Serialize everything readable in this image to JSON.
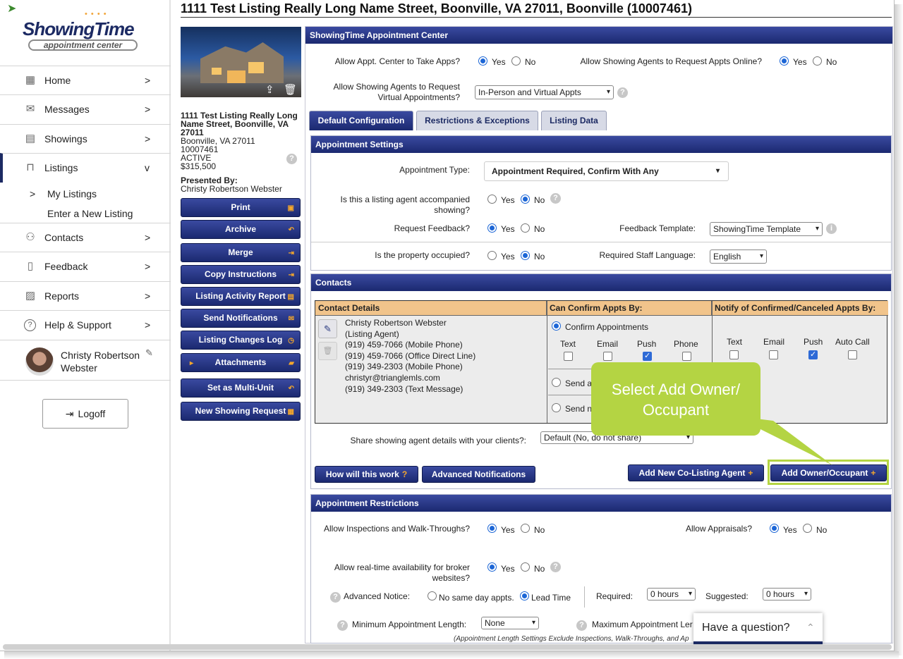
{
  "app": {
    "logo_main": "ShowingTime",
    "logo_sub": "appointment center"
  },
  "nav": {
    "items": [
      {
        "label": "Home",
        "icon": "dashboard-icon",
        "chev": ">"
      },
      {
        "label": "Messages",
        "icon": "envelope-icon",
        "chev": ">"
      },
      {
        "label": "Showings",
        "icon": "calendar-icon",
        "chev": ">"
      },
      {
        "label": "Listings",
        "icon": "sign-icon",
        "chev": "v"
      },
      {
        "label": "Contacts",
        "icon": "people-icon",
        "chev": ">"
      },
      {
        "label": "Feedback",
        "icon": "clipboard-icon",
        "chev": ">"
      },
      {
        "label": "Reports",
        "icon": "report-icon",
        "chev": ">"
      },
      {
        "label": "Help & Support",
        "icon": "question-icon",
        "chev": ">"
      }
    ],
    "sub_items": [
      "My Listings",
      "Enter a New Listing"
    ],
    "sub_chev": ">",
    "user_name": "Christy Robertson Webster",
    "logoff": "Logoff"
  },
  "page_title": "1111 Test Listing Really Long Name Street, Boonville, VA 27011, Boonville (10007461)",
  "listing": {
    "name": "1111 Test Listing Really Long Name Street, Boonville, VA 27011",
    "city": "Boonville, VA 27011",
    "id": "10007461",
    "status": "ACTIVE",
    "price": "$315,500",
    "presented_label": "Presented By:",
    "presented_by": "Christy Robertson Webster"
  },
  "actions": [
    "Print",
    "Archive",
    "Merge",
    "Copy Instructions",
    "Listing Activity Report",
    "Send Notifications",
    "Listing Changes Log",
    "Attachments",
    "Set as Multi-Unit",
    "New Showing Request"
  ],
  "center": {
    "title": "ShowingTime Appointment Center",
    "allow_appt_label": "Allow Appt. Center to Take Apps?",
    "allow_online_label": "Allow Showing Agents to Request Appts Online?",
    "virtual_label": "Allow Showing Agents to Request Virtual Appointments?",
    "virtual_value": "In-Person and Virtual Appts",
    "yes": "Yes",
    "no": "No"
  },
  "tabs": [
    "Default Configuration",
    "Restrictions & Exceptions",
    "Listing Data"
  ],
  "appt_settings": {
    "title": "Appointment Settings",
    "type_label": "Appointment Type:",
    "type_value": "Appointment Required, Confirm With Any",
    "accompanied_label": "Is this a listing agent accompanied showing?",
    "feedback_label": "Request Feedback?",
    "template_label": "Feedback Template:",
    "template_value": "ShowingTime Template",
    "occupied_label": "Is the property occupied?",
    "language_label": "Required Staff Language:",
    "language_value": "English"
  },
  "contacts": {
    "title": "Contacts",
    "headers": [
      "Contact Details",
      "Can Confirm Appts By:",
      "Notify of Confirmed/Canceled Appts By:"
    ],
    "contact_lines": [
      "Christy Robertson Webster",
      "(Listing Agent)",
      "(919) 459-7066 (Mobile Phone)",
      "(919) 459-7066 (Office Direct Line)",
      "(919) 349-2303 (Mobile Phone)",
      "christyr@trianglemls.com",
      "(919) 349-2303 (Text Message)"
    ],
    "confirm_option": "Confirm Appointments",
    "confirm_methods": [
      "Text",
      "Email",
      "Push",
      "Phone"
    ],
    "notify_methods": [
      "Text",
      "Email",
      "Push",
      "Auto Call"
    ],
    "send_a": "Send a",
    "send_n": "Send n",
    "share_label": "Share showing agent details with your clients?:",
    "share_value": "Default (No, do not share)",
    "btn_how": "How will this work",
    "btn_how_icon": "?",
    "btn_adv": "Advanced Notifications",
    "btn_colist": "Add New Co-Listing Agent",
    "btn_owner": "Add Owner/Occupant",
    "plus": "+"
  },
  "callout": "Select Add Owner/ Occupant",
  "restrictions": {
    "title": "Appointment Restrictions",
    "inspections_label": "Allow Inspections and Walk-Throughs?",
    "appraisals_label": "Allow Appraisals?",
    "realtime_label": "Allow real-time availability for broker websites?",
    "notice_label": "Advanced Notice:",
    "no_same_day": "No same day appts.",
    "lead_time": "Lead Time",
    "required_label": "Required:",
    "required_value": "0 hours",
    "suggested_label": "Suggested:",
    "suggested_value": "0 hours",
    "min_label": "Minimum Appointment Length:",
    "min_value": "None",
    "max_label": "Maximum Appointment Ler",
    "note": "(Appointment Length Settings Exclude Inspections, Walk-Throughs, and Ap"
  },
  "chat": {
    "label": "Have a question?"
  },
  "colors": {
    "navy": "#1c2a63",
    "accent": "#f4a72c",
    "callout": "#b4d443",
    "header_cell": "#f1c48b"
  }
}
